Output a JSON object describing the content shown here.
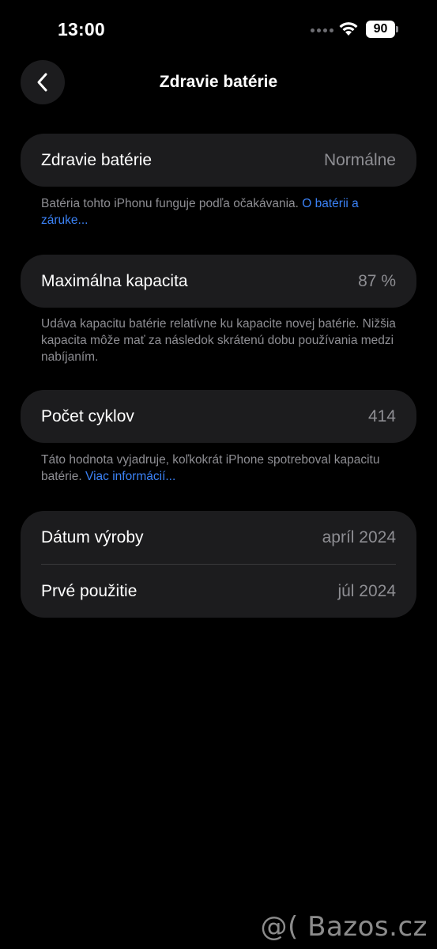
{
  "status_bar": {
    "time": "13:00",
    "battery_level": "90",
    "icons": [
      "signal-dots-icon",
      "wifi-icon",
      "battery-icon"
    ]
  },
  "nav": {
    "title": "Zdravie batérie",
    "back_icon": "chevron-left-icon"
  },
  "sections": {
    "health": {
      "label": "Zdravie batérie",
      "value": "Normálne",
      "footnote_text": "Batéria tohto iPhonu funguje podľa očakávania. ",
      "footnote_link": "O batérii a záruke..."
    },
    "capacity": {
      "label": "Maximálna kapacita",
      "value": "87 %",
      "footnote_text": "Udáva kapacitu batérie relatívne ku kapacite novej batérie. Nižšia kapacita môže mať za následok skrátenú dobu používania medzi nabíjaním."
    },
    "cycles": {
      "label": "Počet cyklov",
      "value": "414",
      "footnote_text": "Táto hodnota vyjadruje, koľkokrát iPhone spotreboval kapacitu batérie. ",
      "footnote_link": "Viac informácií..."
    },
    "dates": {
      "manufacture_label": "Dátum výroby",
      "manufacture_value": "apríl 2024",
      "first_use_label": "Prvé použitie",
      "first_use_value": "júl 2024"
    }
  },
  "watermark": "@( Bazos.cz",
  "colors": {
    "background": "#000000",
    "card": "#1c1c1e",
    "secondary_text": "#8e8e93",
    "link": "#3b82f6"
  }
}
